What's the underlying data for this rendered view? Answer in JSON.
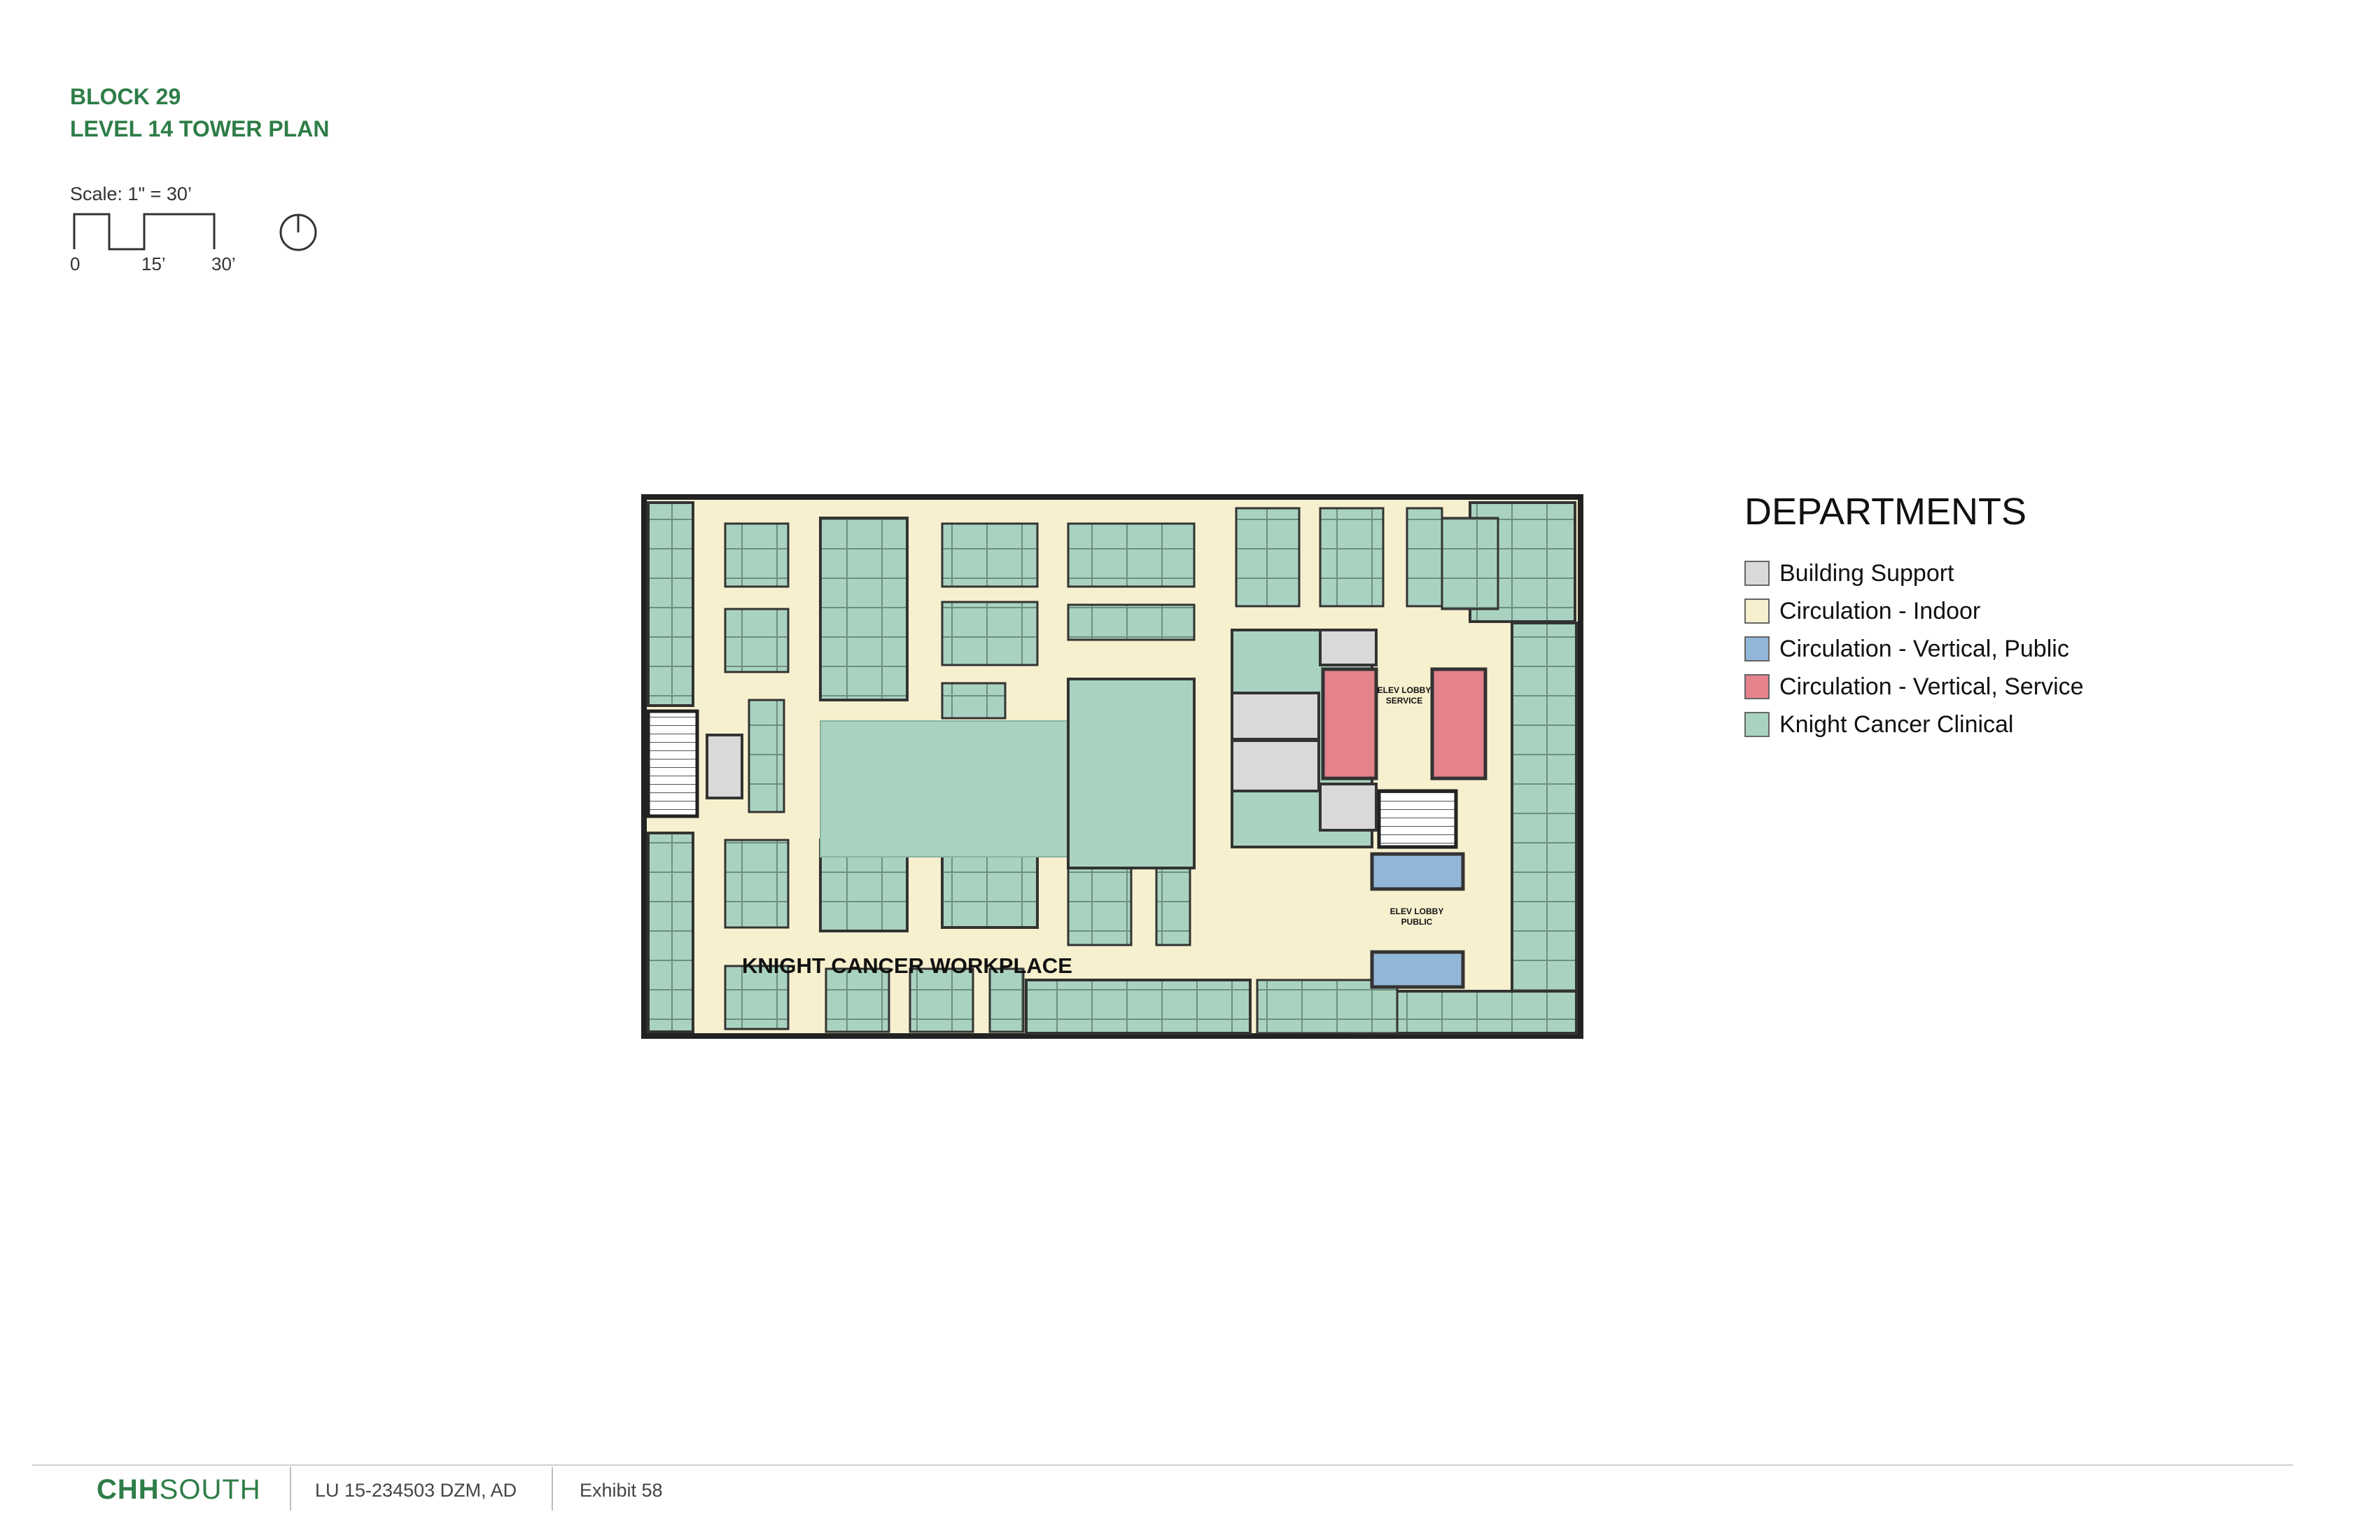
{
  "header": {
    "title_line1": "BLOCK 29",
    "title_line2": "LEVEL 14 TOWER PLAN",
    "scale_label": "Scale: 1\" = 30’",
    "scale_ticks": [
      "0",
      "15’",
      "30’"
    ]
  },
  "plan": {
    "workplace_label": "KNIGHT CANCER WORKPLACE",
    "service_lobby_line1": "ELEV LOBBY",
    "service_lobby_line2": "SERVICE",
    "public_lobby_line1": "ELEV LOBBY",
    "public_lobby_line2": "PUBLIC"
  },
  "legend": {
    "title": "DEPARTMENTS",
    "items": [
      {
        "label": "Building Support",
        "color": "#d9d9d9"
      },
      {
        "label": "Circulation - Indoor",
        "color": "#f7f0cf"
      },
      {
        "label": "Circulation - Vertical, Public",
        "color": "#93b7d9"
      },
      {
        "label": "Circulation - Vertical, Service",
        "color": "#e5838c"
      },
      {
        "label": "Knight Cancer Clinical",
        "color": "#a9d3c0"
      }
    ]
  },
  "footer": {
    "logo_bold": "CHH",
    "logo_light": "SOUTH",
    "project_ref": "LU 15-234503 DZM, AD",
    "exhibit": "Exhibit 58"
  },
  "colors": {
    "brand_green": "#2e7d47",
    "clinical": "#a9d3c0",
    "circulation": "#f7f0cf",
    "support": "#d9d9d9",
    "vertical_public": "#93b7d9",
    "vertical_service": "#e5838c"
  }
}
